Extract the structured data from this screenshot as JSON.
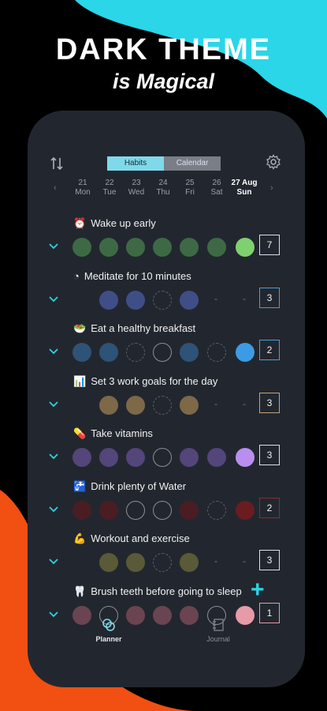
{
  "promo": {
    "title": "DARK THEME",
    "subtitle": "is Magical"
  },
  "colors": {
    "cyan": "#2ad6e8",
    "orange": "#f24f12",
    "panel": "#22272f",
    "accent": "#7fd9ea"
  },
  "header": {
    "tabs": [
      "Habits",
      "Calendar"
    ],
    "active_tab": "Habits",
    "sort_icon": "sort-icon",
    "settings_icon": "gear-icon"
  },
  "days": [
    {
      "num": "21",
      "name": "Mon"
    },
    {
      "num": "22",
      "name": "Tue"
    },
    {
      "num": "23",
      "name": "Wed"
    },
    {
      "num": "24",
      "name": "Thu"
    },
    {
      "num": "25",
      "name": "Fri"
    },
    {
      "num": "26",
      "name": "Sat"
    },
    {
      "num": "27 Aug",
      "name": "Sun"
    }
  ],
  "habits": [
    {
      "icon": "⏰",
      "title": "Wake up early",
      "count": "7",
      "states": [
        "done",
        "done",
        "done",
        "done",
        "done",
        "done",
        "today"
      ],
      "color": "#3d6a45",
      "today_color": "#7ed16e",
      "count_border": "#dde"
    },
    {
      "icon": "◔",
      "title": "Meditate for 10 minutes",
      "count": "3",
      "states": [
        "blank",
        "done",
        "done",
        "ring",
        "done",
        "dash",
        "dash"
      ],
      "color": "#3f4e86",
      "today_color": "#3f4e86",
      "count_border": "#4a9fd6"
    },
    {
      "icon": "🥗",
      "title": "Eat a healthy breakfast",
      "count": "2",
      "states": [
        "done",
        "done",
        "ring",
        "empty",
        "done",
        "ring",
        "today"
      ],
      "color": "#2f5277",
      "today_color": "#3d9be6",
      "count_border": "#4a9fd6"
    },
    {
      "icon": "📊",
      "title": "Set 3 work goals for the day",
      "count": "3",
      "states": [
        "blank",
        "done",
        "done",
        "ring",
        "done",
        "dash",
        "dash"
      ],
      "color": "#7d6848",
      "today_color": "#7d6848",
      "count_border": "#c9a27a"
    },
    {
      "icon": "💊",
      "title": "Take vitamins",
      "count": "3",
      "states": [
        "done",
        "done",
        "done",
        "empty",
        "done",
        "done",
        "today"
      ],
      "color": "#54457a",
      "today_color": "#b98ef0",
      "count_border": "#dde"
    },
    {
      "icon": "🚰",
      "title": "Drink plenty of Water",
      "count": "2",
      "states": [
        "done",
        "done",
        "empty",
        "empty",
        "done",
        "ring",
        "today"
      ],
      "color": "#4a1d22",
      "today_color": "#6a1c20",
      "count_border": "#8a2b30"
    },
    {
      "icon": "💪",
      "title": "Workout and exercise",
      "count": "3",
      "states": [
        "blank",
        "done",
        "done",
        "ring",
        "done",
        "dash",
        "dash"
      ],
      "color": "#5a5a38",
      "today_color": "#5a5a38",
      "count_border": "#dde"
    },
    {
      "icon": "🦷",
      "title": "Brush teeth before going to sleep",
      "count": "1",
      "states": [
        "done",
        "empty",
        "done",
        "done",
        "done",
        "empty",
        "today"
      ],
      "color": "#6a4450",
      "today_color": "#e79aa8",
      "count_border": "#e79aa8"
    }
  ],
  "nav": {
    "planner": "Planner",
    "journal": "Journal"
  }
}
